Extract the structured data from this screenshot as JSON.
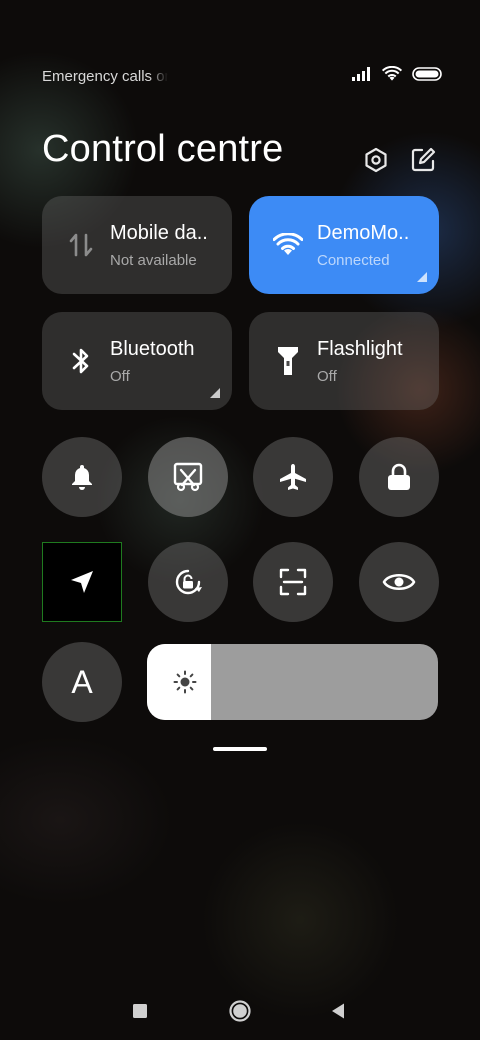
{
  "status_bar": {
    "carrier_text": "Emergency calls only",
    "icons": [
      "signal-icon",
      "wifi-icon",
      "battery-icon"
    ]
  },
  "header": {
    "title": "Control centre",
    "icons": [
      "settings-icon",
      "edit-icon"
    ]
  },
  "tiles": [
    {
      "label": "Mobile da..",
      "sub": "Not available",
      "icon": "mobile-data-icon",
      "active": false
    },
    {
      "label": "DemoMo..",
      "sub": "Connected",
      "icon": "wifi-icon",
      "active": true
    },
    {
      "label": "Bluetooth",
      "sub": "Off",
      "icon": "bluetooth-icon",
      "active": false
    },
    {
      "label": "Flashlight",
      "sub": "Off",
      "icon": "flashlight-icon",
      "active": false
    }
  ],
  "toggles": [
    "bell-icon",
    "screenshot-icon",
    "airplane-icon",
    "lock-icon",
    "location-icon",
    "rotation-lock-icon",
    "scan-icon",
    "eye-icon",
    "auto-brightness-icon"
  ],
  "auto_brightness_label": "A",
  "brightness": {
    "level": 0.22
  },
  "nav_bar": [
    "recents-icon",
    "home-icon",
    "back-icon"
  ],
  "colors": {
    "accent": "#3d8bf5",
    "tile_bg": "#4a4a4a",
    "slider_track": "#9d9d9d"
  }
}
